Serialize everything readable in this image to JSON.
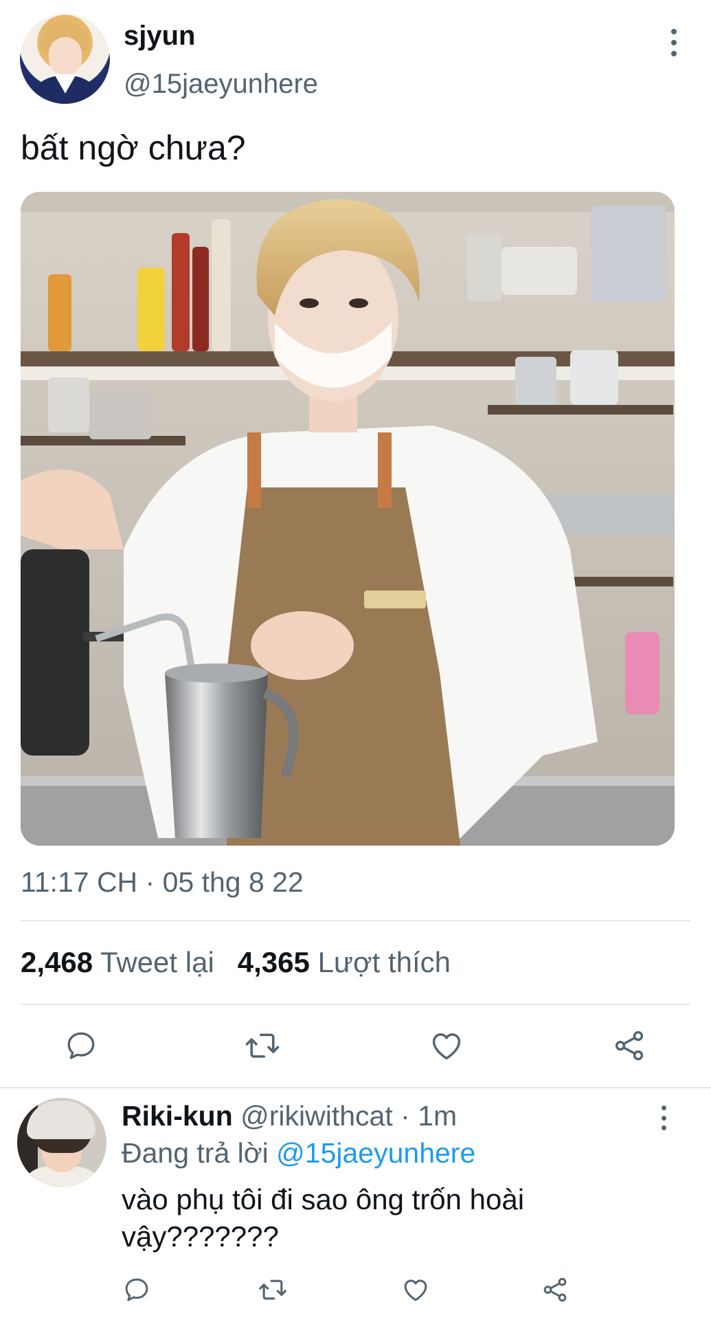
{
  "tweet": {
    "author": {
      "display_name": "sjyun",
      "handle": "@15jaeyunhere"
    },
    "text": "bất ngờ chưa?",
    "timestamp": "11:17 CH · 05 thg 8 22",
    "stats": {
      "retweets_count": "2,468",
      "retweets_label": "Tweet lại",
      "likes_count": "4,365",
      "likes_label": "Lượt thích"
    }
  },
  "actions": {
    "icons": [
      "reply-icon",
      "retweet-icon",
      "like-icon",
      "share-icon"
    ]
  },
  "reply": {
    "display_name": "Riki-kun",
    "handle": "@rikiwithcat",
    "dot": "·",
    "time": "1m",
    "replying_prefix": "Đang trả lời",
    "replying_to": "@15jaeyunhere",
    "text": "vào phụ tôi đi sao ông trốn hoài vậy???????"
  },
  "colors": {
    "text_primary": "#0f1419",
    "text_secondary": "#536471",
    "link": "#1d9bf0",
    "divider": "#e4e7ea"
  }
}
